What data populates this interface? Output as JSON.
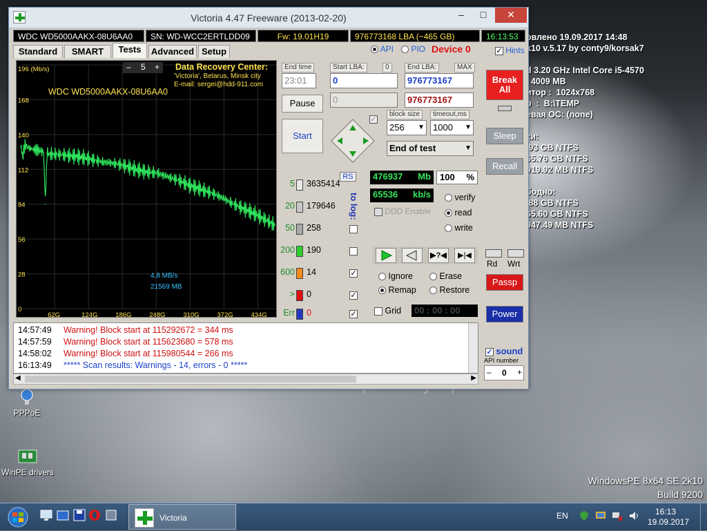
{
  "desktop": {
    "sysinfo": "овлено 19.09.2017 14:48\nk10 v.5.17 by conty9/korsak7\n\nd 3.20 GHz Intel Core i5-4570\n  4009 MB\nитор :  1024x768\nр  :  B:\\TEMP\nевая ОС: (none)\n\nки:\n.93 GB NTFS\n65.76 GB NTFS\n019.92 MB NTFS\n\nбодно:\n.88 GB NTFS\n65.60 GB NTFS\n047.49 MB NTFS",
    "windows_line1": "WindowsPE 8x64 SE 2k10",
    "windows_line2": "Build 9200",
    "icons": [
      {
        "label": "PPPoE"
      },
      {
        "label": "WinPE drivers"
      }
    ],
    "watermark": "au.ru",
    "watermark_sub": "интернет-аукцион"
  },
  "window": {
    "title": "Victoria 4.47  Freeware (2013-02-20)",
    "minimize": "–",
    "maximize": "□",
    "close": "✕",
    "info": {
      "model": "WDC WD5000AAKX-08U6AA0",
      "serial": "SN: WD-WCC2ERTLDD09",
      "firmware": "Fw: 19.01H19",
      "lba": "976773168 LBA (~465 GB)",
      "time": "16:13:53"
    },
    "tabs": [
      "Standard",
      "SMART",
      "Tests",
      "Advanced",
      "Setup"
    ],
    "active_tab": "Tests",
    "api_label": "API",
    "pio_label": "PIO",
    "device_label": "Device 0",
    "hints_label": "Hints"
  },
  "graph": {
    "drive_label": "WDC WD5000AAKX-08U6AA0",
    "zoom_value": "5",
    "zoom_minus": "–",
    "zoom_plus": "+",
    "drc_title": "Data Recovery Center:",
    "drc_line1": "'Victoria', Belarus, Minsk city",
    "drc_line2": "E-mail: sergei@hdd-911.com",
    "speed_readout": "4,8 MB/s",
    "size_readout": "21569 MB",
    "yticks": [
      "196 (Mb/s)",
      "168",
      "140",
      "112",
      "84",
      "56",
      "28",
      "0"
    ],
    "xticks": [
      "62G",
      "124G",
      "186G",
      "248G",
      "310G",
      "372G",
      "434G"
    ]
  },
  "chart_data": {
    "type": "line",
    "title": "",
    "xlabel": "",
    "ylabel": "Mb/s",
    "xlim": [
      0,
      465
    ],
    "ylim": [
      0,
      196
    ],
    "x": [
      0,
      3,
      8,
      15,
      25,
      35,
      42,
      45,
      48,
      55,
      70,
      90,
      110,
      130,
      150,
      170,
      190,
      210,
      230,
      250,
      270,
      290,
      310,
      330,
      350,
      370,
      390,
      410,
      430,
      450,
      465
    ],
    "y": [
      130,
      122,
      132,
      129,
      128,
      127,
      126,
      84,
      125,
      124,
      124,
      123,
      122,
      120,
      118,
      117,
      115,
      112,
      110,
      109,
      106,
      103,
      99,
      96,
      93,
      89,
      84,
      80,
      76,
      71,
      67
    ]
  },
  "controls": {
    "end_time_label": "End time",
    "end_time_value": "23:01",
    "start_lba_label": "Start LBA:",
    "start_lba_btn": "0",
    "start_lba_value": "0",
    "end_lba_label": "End LBA:",
    "end_lba_btn": "MAX",
    "end_lba_value": "976773167",
    "end_lba_value2": "976773167",
    "current_value": "0",
    "pause_label": "Pause",
    "start_label": "Start",
    "block_size_label": "block size",
    "block_size_value": "256",
    "timeout_label": "timeout,ms",
    "timeout_value": "1000",
    "end_of_test": "End of test"
  },
  "counters": {
    "rs_label": "RS",
    "to_log_label": "to log:",
    "rows": [
      {
        "ms": "5",
        "count": "3635414",
        "color": "#e8e8e8"
      },
      {
        "ms": "20",
        "count": "179646",
        "color": "#c8c8c8"
      },
      {
        "ms": "50",
        "count": "258",
        "color": "#a8a8a8"
      },
      {
        "ms": "200",
        "count": "190",
        "color": "#2ed02e"
      },
      {
        "ms": "600",
        "count": "14",
        "color": "#f08a1a"
      },
      {
        "ms": ">",
        "count": "0",
        "color": "#e01010"
      },
      {
        "ms": "Err",
        "count": "0",
        "color": "#2238c0"
      }
    ]
  },
  "status": {
    "mb_value": "476937",
    "mb_unit": "Mb",
    "percent": "100",
    "percent_unit": "%",
    "speed_value": "65536",
    "speed_unit": "kb/s",
    "ddd_label": "DDD Enable",
    "verify_label": "verify",
    "read_label": "read",
    "write_label": "write",
    "ignore_label": "Ignore",
    "erase_label": "Erase",
    "remap_label": "Remap",
    "restore_label": "Restore",
    "grid_label": "Grid",
    "grid_time": "00 : 00 : 00"
  },
  "sidebar": {
    "break_all": "Break All",
    "sleep": "Sleep",
    "recall": "Recall",
    "rd": "Rd",
    "wrt": "Wrt",
    "passp": "Passp",
    "power": "Power",
    "sound": "sound",
    "api_number_label": "API number",
    "api_number_value": "0",
    "minus": "–",
    "plus": "+"
  },
  "log": [
    {
      "time": "14:57:49",
      "msg": "Warning! Block start at 115292672 = 344 ms",
      "color": "#d01010"
    },
    {
      "time": "14:57:59",
      "msg": "Warning! Block start at 115623680 = 578 ms",
      "color": "#d01010"
    },
    {
      "time": "14:58:02",
      "msg": "Warning! Block start at 115980544 = 266 ms",
      "color": "#d01010"
    },
    {
      "time": "16:13:49",
      "msg": "***** Scan results: Warnings - 14, errors - 0 *****",
      "color": "#1c3fc8"
    }
  ],
  "taskbar": {
    "task_label": "Victoria",
    "lang": "EN",
    "clock_time": "16:13",
    "clock_date": "19.09.2017"
  }
}
